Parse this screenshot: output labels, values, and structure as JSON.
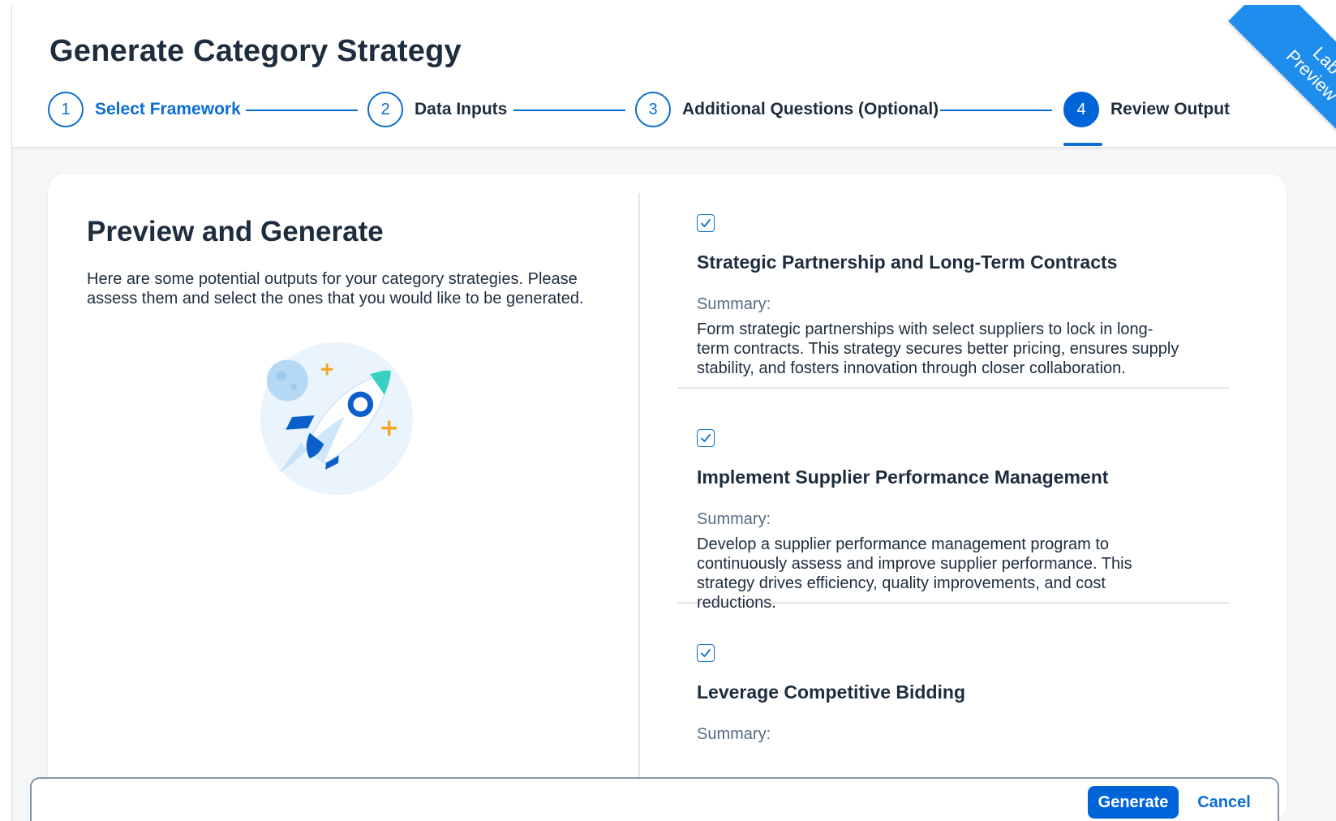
{
  "dialog": {
    "title": "Generate Category Strategy",
    "badge": {
      "line1": "Lab",
      "line2": "Preview",
      "color": "#1f8ded"
    }
  },
  "wizard": {
    "accent": "#0a6ed1",
    "steps": [
      {
        "number": "1",
        "label": "Select Framework",
        "state": "link"
      },
      {
        "number": "2",
        "label": "Data Inputs",
        "state": "default"
      },
      {
        "number": "3",
        "label": "Additional Questions (Optional)",
        "state": "default"
      },
      {
        "number": "4",
        "label": "Review Output",
        "state": "active"
      }
    ]
  },
  "preview": {
    "title": "Preview and Generate",
    "description": "Here are some potential outputs for your category strategies. Please assess them and select the ones that you would like to be generated.",
    "illustration": "rocket-launch-illustration"
  },
  "options": [
    {
      "checked": true,
      "title": "Strategic Partnership and Long-Term Contracts",
      "summary_label": "Summary:",
      "summary": "Form strategic partnerships with select suppliers to lock in long-term contracts. This strategy secures better pricing, ensures supply stability, and fosters innovation through closer collaboration."
    },
    {
      "checked": true,
      "title": "Implement Supplier Performance Management",
      "summary_label": "Summary:",
      "summary": "Develop a supplier performance management program to continuously assess and improve supplier performance. This strategy drives efficiency, quality improvements, and cost reductions."
    },
    {
      "checked": true,
      "title": "Leverage Competitive Bidding",
      "summary_label": "Summary:",
      "summary": ""
    }
  ],
  "footer": {
    "generate_label": "Generate",
    "cancel_label": "Cancel",
    "primary_color": "#0064d9"
  }
}
